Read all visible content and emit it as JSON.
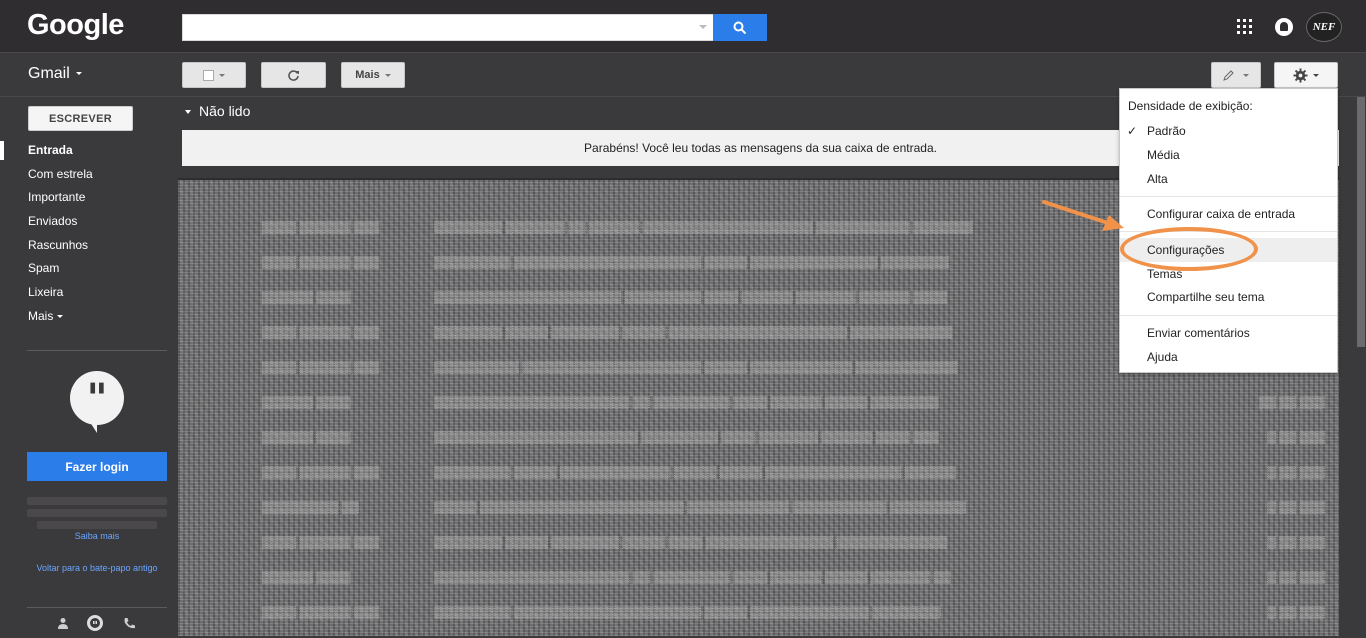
{
  "header": {
    "logo_text": "Google",
    "avatar_text": "NEF"
  },
  "toolbar": {
    "app_label": "Gmail",
    "more_label": "Mais"
  },
  "sidebar": {
    "compose_label": "ESCREVER",
    "items": [
      {
        "label": "Entrada",
        "active": true
      },
      {
        "label": "Com estrela"
      },
      {
        "label": "Importante"
      },
      {
        "label": "Enviados"
      },
      {
        "label": "Rascunhos"
      },
      {
        "label": "Spam"
      },
      {
        "label": "Lixeira"
      },
      {
        "label": "Mais"
      }
    ],
    "hangouts": {
      "login_label": "Fazer login",
      "learn_more": "Saiba mais",
      "back_link": "Voltar para o bate-papo antigo"
    }
  },
  "main": {
    "section_title": "Não lido",
    "banner_text": "Parabéns! Você leu todas as mensagens da sua caixa de entrada."
  },
  "settings_menu": {
    "density_header": "Densidade de exibição:",
    "density_options": [
      "Padrão",
      "Média",
      "Alta"
    ],
    "items": [
      "Configurar caixa de entrada",
      "Configurações",
      "Temas",
      "Compartilhe seu tema",
      "Enviar comentários",
      "Ajuda"
    ],
    "check_mark": "✓"
  },
  "colors": {
    "accent_blue": "#2b7de9",
    "annotation_orange": "#f0924a",
    "dark_bg": "#3a3a3c"
  }
}
